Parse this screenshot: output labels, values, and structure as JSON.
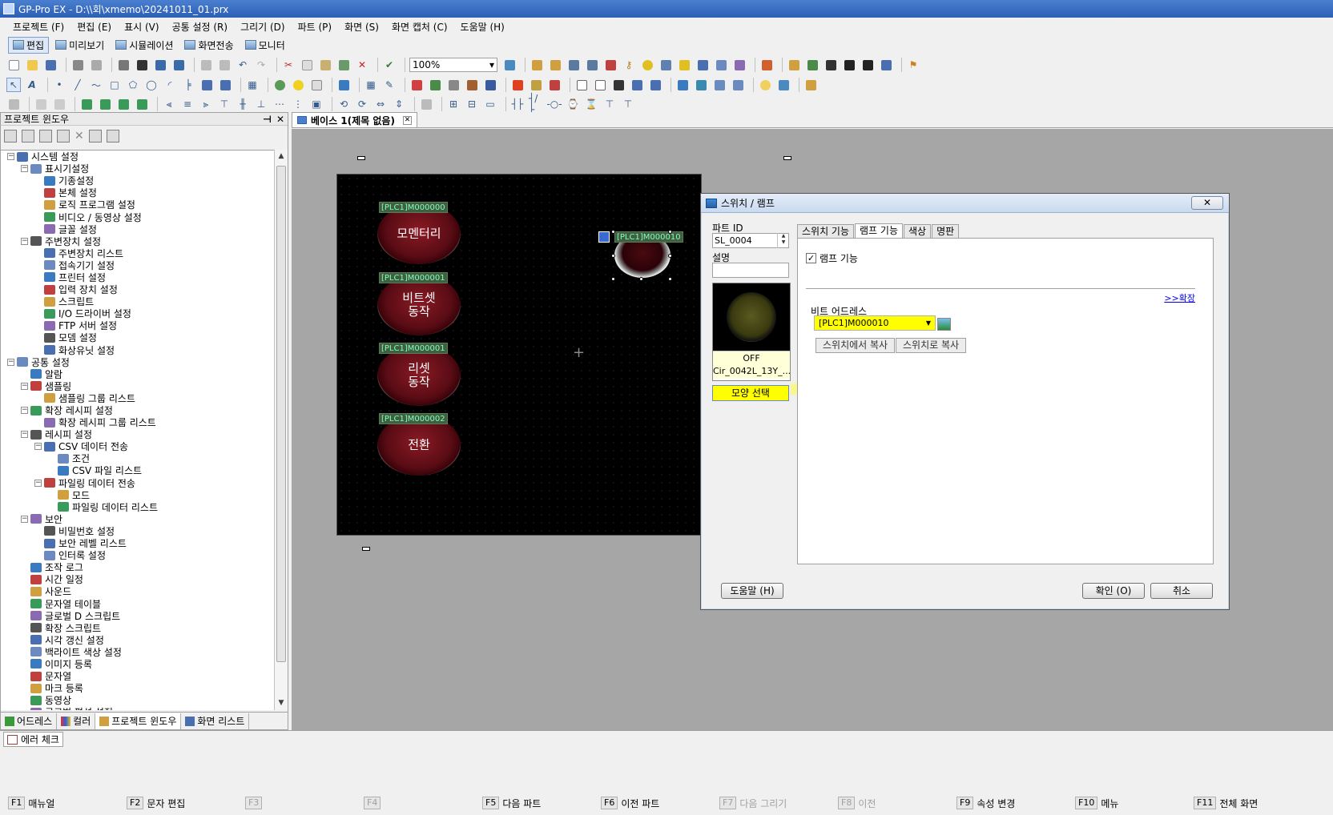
{
  "window": {
    "title": "GP-Pro EX - D:\\\\회\\xmemo\\20241011_01.prx"
  },
  "menu": [
    "프로젝트 (F)",
    "편집 (E)",
    "표시 (V)",
    "공통 설정 (R)",
    "그리기 (D)",
    "파트 (P)",
    "화면 (S)",
    "화면 캡처 (C)",
    "도움말 (H)"
  ],
  "modes": [
    "편집",
    "미리보기",
    "시뮬레이션",
    "화면전송",
    "모니터"
  ],
  "toolbar": {
    "zoom": "100%"
  },
  "project_window": {
    "title": "프로젝트 윈도우",
    "tree": [
      {
        "label": "시스템 설정",
        "level": 0,
        "exp": "-"
      },
      {
        "label": "표시기설정",
        "level": 1,
        "exp": "-"
      },
      {
        "label": "기종설정",
        "level": 2
      },
      {
        "label": "본체 설정",
        "level": 2
      },
      {
        "label": "로직 프로그램 설정",
        "level": 2
      },
      {
        "label": "비디오 / 동영상 설정",
        "level": 2
      },
      {
        "label": "글꼴 설정",
        "level": 2
      },
      {
        "label": "주변장치 설정",
        "level": 1,
        "exp": "-"
      },
      {
        "label": "주변장치 리스트",
        "level": 2
      },
      {
        "label": "접속기기 설정",
        "level": 2
      },
      {
        "label": "프린터 설정",
        "level": 2
      },
      {
        "label": "입력 장치 설정",
        "level": 2
      },
      {
        "label": "스크립트",
        "level": 2
      },
      {
        "label": "I/O 드라이버 설정",
        "level": 2
      },
      {
        "label": "FTP 서버 설정",
        "level": 2
      },
      {
        "label": "모뎀 설정",
        "level": 2
      },
      {
        "label": "화상유닛 설정",
        "level": 2
      },
      {
        "label": "공통 설정",
        "level": 0,
        "exp": "-"
      },
      {
        "label": "알람",
        "level": 1
      },
      {
        "label": "샘플링",
        "level": 1,
        "exp": "-"
      },
      {
        "label": "샘플링 그룹 리스트",
        "level": 2
      },
      {
        "label": "확장 레시피 설정",
        "level": 1,
        "exp": "-"
      },
      {
        "label": "확장 레시피 그룹 리스트",
        "level": 2
      },
      {
        "label": "레시피 설정",
        "level": 1,
        "exp": "-"
      },
      {
        "label": "CSV 데이터 전송",
        "level": 2,
        "exp": "-"
      },
      {
        "label": "조건",
        "level": 3
      },
      {
        "label": "CSV 파일 리스트",
        "level": 3
      },
      {
        "label": "파일링 데이터 전송",
        "level": 2,
        "exp": "-"
      },
      {
        "label": "모드",
        "level": 3
      },
      {
        "label": "파일링 데이터 리스트",
        "level": 3
      },
      {
        "label": "보안",
        "level": 1,
        "exp": "-"
      },
      {
        "label": "비밀번호 설정",
        "level": 2
      },
      {
        "label": "보안 레벨 리스트",
        "level": 2
      },
      {
        "label": "인터록 설정",
        "level": 2
      },
      {
        "label": "조작 로그",
        "level": 1
      },
      {
        "label": "시간 일정",
        "level": 1
      },
      {
        "label": "사운드",
        "level": 1
      },
      {
        "label": "문자열 테이블",
        "level": 1
      },
      {
        "label": "글로벌 D 스크립트",
        "level": 1
      },
      {
        "label": "확장 스크립트",
        "level": 1
      },
      {
        "label": "시각 갱신 설정",
        "level": 1
      },
      {
        "label": "백라이트 색상 설정",
        "level": 1
      },
      {
        "label": "이미지 등록",
        "level": 1
      },
      {
        "label": "문자열",
        "level": 1
      },
      {
        "label": "마크 등록",
        "level": 1
      },
      {
        "label": "동영상",
        "level": 1
      },
      {
        "label": "글로벌 편성 설정",
        "level": 1
      }
    ],
    "bottom_tabs": [
      "어드레스",
      "컬러",
      "프로젝트 윈도우",
      "화면 리스트"
    ]
  },
  "document": {
    "tab": "베이스 1(제목 없음)"
  },
  "canvas": {
    "buttons": [
      {
        "tag": "[PLC1]M000000",
        "label": "모멘터리"
      },
      {
        "tag": "[PLC1]M000001",
        "label": "비트셋\n동작"
      },
      {
        "tag": "[PLC1]M000001",
        "label": "리셋\n동작"
      },
      {
        "tag": "[PLC1]M000002",
        "label": "전환"
      }
    ],
    "lamp_tag": "[PLC1]M000010"
  },
  "dialog": {
    "title": "스위치 / 램프",
    "close_label": "✕",
    "part_id_label": "파트 ID",
    "part_id": "SL_0004",
    "desc_label": "설명",
    "desc": "",
    "preview_state": "OFF",
    "preview_name": "Cir_0042L_13Y_...",
    "shape_select": "모양 선택",
    "tabs": [
      "스위치 기능",
      "램프 기능",
      "색상",
      "명판"
    ],
    "active_tab": 1,
    "lamp_function_label": "램프 기능",
    "lamp_function_checked": true,
    "expand_link": ">>확장",
    "bit_address_label": "비트 어드레스",
    "bit_address": "[PLC1]M000010",
    "copy_from_switch": "스위치에서 복사",
    "copy_to_switch": "스위치로 복사",
    "help": "도움말 (H)",
    "ok": "확인 (O)",
    "cancel": "취소"
  },
  "error_check": "에러 체크",
  "fkeys": [
    {
      "key": "F1",
      "label": "매뉴얼",
      "enabled": true
    },
    {
      "key": "F2",
      "label": "문자 편집",
      "enabled": true
    },
    {
      "key": "F3",
      "label": "",
      "enabled": false
    },
    {
      "key": "F4",
      "label": "",
      "enabled": false
    },
    {
      "key": "F5",
      "label": "다음 파트",
      "enabled": true
    },
    {
      "key": "F6",
      "label": "이전 파트",
      "enabled": true
    },
    {
      "key": "F7",
      "label": "다음 그리기",
      "enabled": false
    },
    {
      "key": "F8",
      "label": "이전",
      "enabled": false
    },
    {
      "key": "F9",
      "label": "속성 변경",
      "enabled": true
    },
    {
      "key": "F10",
      "label": "메뉴",
      "enabled": true
    },
    {
      "key": "F11",
      "label": "전체 화면",
      "enabled": true
    }
  ]
}
